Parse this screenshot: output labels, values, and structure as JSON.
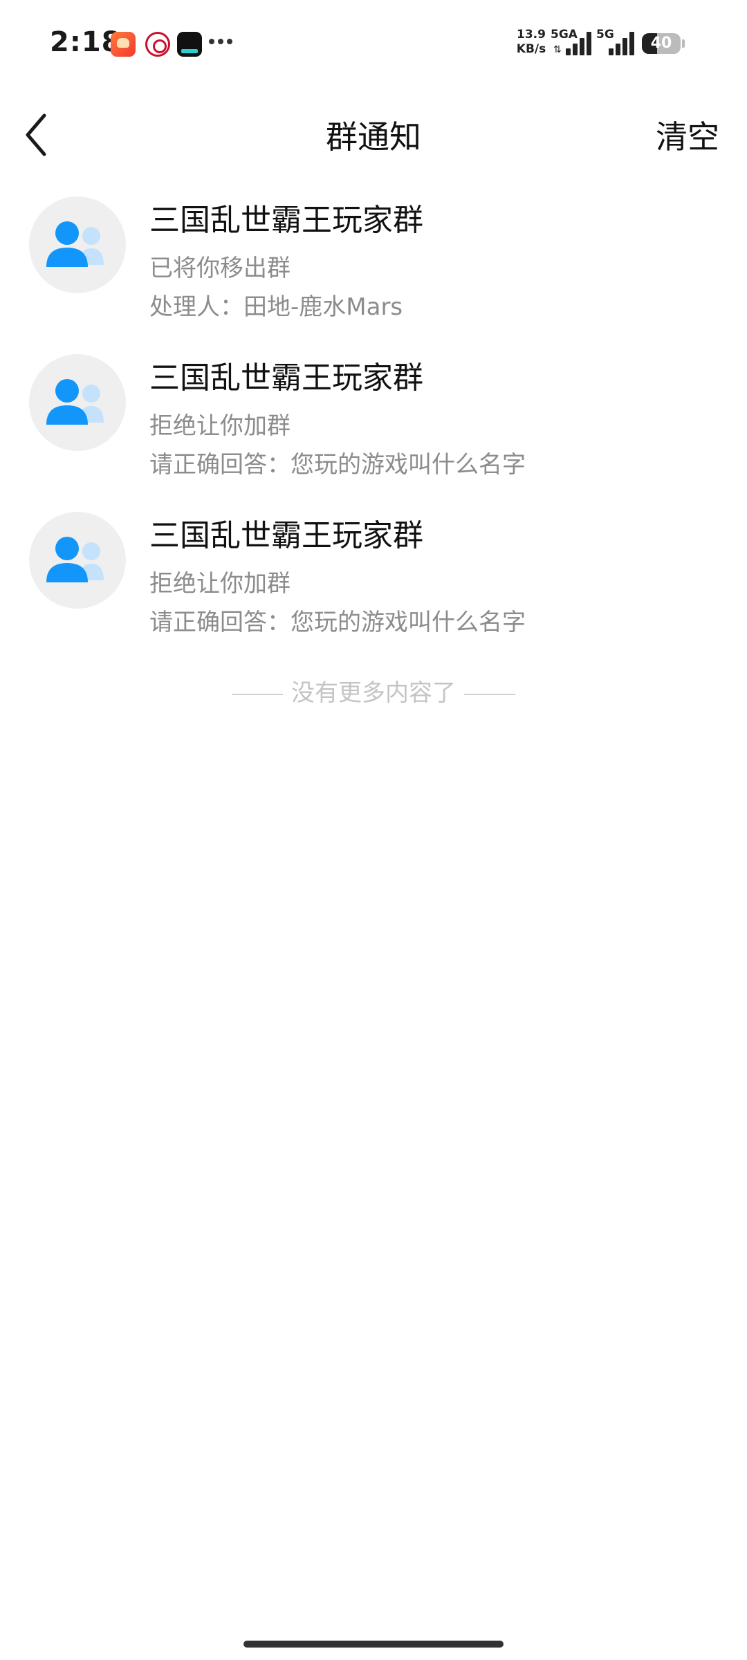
{
  "status_bar": {
    "time": "2:18",
    "app_icons": [
      "app-icon",
      "china-merchants-bank-icon",
      "news-app-icon"
    ],
    "more": "more-dots-icon",
    "net_speed_value": "13.9",
    "net_speed_unit": "KB/s",
    "network_1": "5GA",
    "network_2": "5G",
    "battery_level": "40"
  },
  "nav": {
    "title": "群通知",
    "back_icon": "back-chevron-icon",
    "clear_label": "清空"
  },
  "notices": [
    {
      "group_name": "三国乱世霸王玩家群",
      "status": "已将你移出群",
      "detail": "处理人：田地-鹿水Mars",
      "avatar_icon": "group-avatar-icon"
    },
    {
      "group_name": "三国乱世霸王玩家群",
      "status": "拒绝让你加群",
      "detail": "请正确回答：您玩的游戏叫什么名字",
      "avatar_icon": "group-avatar-icon"
    },
    {
      "group_name": "三国乱世霸王玩家群",
      "status": "拒绝让你加群",
      "detail": "请正确回答：您玩的游戏叫什么名字",
      "avatar_icon": "group-avatar-icon"
    }
  ],
  "end_hint": "没有更多内容了",
  "colors": {
    "avatar_primary": "#1296fa",
    "avatar_secondary": "#c4e2fb",
    "avatar_background": "#efefef",
    "secondary_text": "#8c8c8c",
    "hint_text": "#c4c4c4"
  }
}
